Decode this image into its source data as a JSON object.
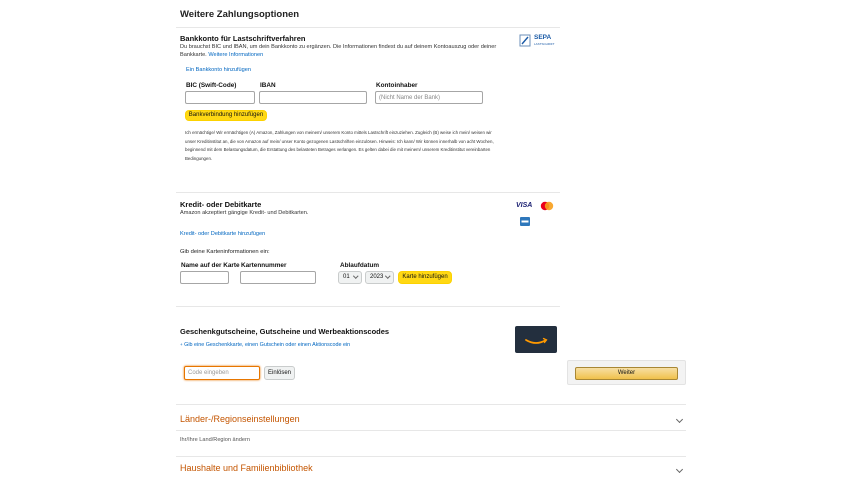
{
  "page_title": "Weitere Zahlungsoptionen",
  "bank": {
    "title": "Bankkonto für Lastschriftverfahren",
    "desc_1": "Du brauchst BIC und IBAN, um dein Bankkonto zu ergänzen. Die Informationen findest du auf deinem Kontoauszug oder deiner",
    "desc_2_prefix": "Bankkarte.",
    "more_info_link": "Weitere Informationen",
    "add_link": "Ein Bankkonto hinzufügen",
    "bic_label": "BIC (Swift-Code)",
    "iban_label": "IBAN",
    "holder_label": "Kontoinhaber",
    "holder_placeholder": "(Nicht Name der Bank)",
    "add_button": "Bankverbindung hinzufügen",
    "mandate_1": "Ich ermächtige/ Wir ermächtigen (A) Amazon, Zahlungen von meinem/ unserem Konto mittels Lastschrift einzuziehen. Zugleich (B) weise ich mein/ weisen wir",
    "mandate_2": "unser Kreditinstitut an, die von Amazon auf mein/ unser Konto gezogenen Lastschriften einzulösen. Hinweis: Ich kann/ Wir können innerhalb von acht Wochen,",
    "mandate_3": "beginnend mit dem Belastungsdatum, die Erstattung des belasteten Betrages verlangen. Es gelten dabei die mit meinem/ unserem Kreditinstitut vereinbarten",
    "mandate_4": "Bedingungen.",
    "sepa_logo": "SEPA",
    "sepa_sub": "LASTSCHRIFT"
  },
  "card": {
    "title": "Kredit- oder Debitkarte",
    "desc": "Amazon akzeptiert gängige Kredit- und Debitkarten.",
    "add_link": "Kredit- oder Debitkarte hinzufügen",
    "info_prompt": "Gib deine Karteninformationen ein:",
    "name_label": "Name auf der Karte",
    "number_label": "Kartennummer",
    "expiry_label": "Ablaufdatum",
    "month": "01",
    "year": "2023",
    "add_button": "Karte hinzufügen",
    "visa_logo": "VISA"
  },
  "gift": {
    "title": "Geschenkgutscheine, Gutscheine und Werbeaktionscodes",
    "link": "Gib eine Geschenkkarte, einen Gutschein oder einen Aktionscode ein",
    "code_placeholder": "Code eingeben",
    "redeem_button": "Einlösen"
  },
  "continue_button": "Weiter",
  "region": {
    "title": "Länder-/Regionseinstellungen",
    "desc": "Ihr/Ihre Land/Region ändern"
  },
  "household": {
    "title": "Haushalte und Familienbibliothek"
  },
  "colors": {
    "accent_yellow": "#ffd814",
    "link_blue": "#0066c0",
    "section_orange": "#c45500"
  }
}
